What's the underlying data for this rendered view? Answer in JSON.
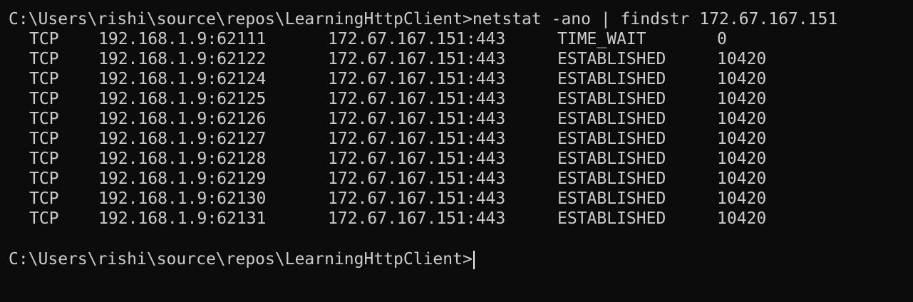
{
  "terminal": {
    "command_line": "C:\\Users\\rishi\\source\\repos\\LearningHttpClient>netstat -ano | findstr 172.67.167.151",
    "rows": [
      {
        "proto": "TCP",
        "local": "192.168.1.9:62111",
        "foreign": "172.67.167.151:443",
        "state": "TIME_WAIT",
        "pid": "0"
      },
      {
        "proto": "TCP",
        "local": "192.168.1.9:62122",
        "foreign": "172.67.167.151:443",
        "state": "ESTABLISHED",
        "pid": "10420"
      },
      {
        "proto": "TCP",
        "local": "192.168.1.9:62124",
        "foreign": "172.67.167.151:443",
        "state": "ESTABLISHED",
        "pid": "10420"
      },
      {
        "proto": "TCP",
        "local": "192.168.1.9:62125",
        "foreign": "172.67.167.151:443",
        "state": "ESTABLISHED",
        "pid": "10420"
      },
      {
        "proto": "TCP",
        "local": "192.168.1.9:62126",
        "foreign": "172.67.167.151:443",
        "state": "ESTABLISHED",
        "pid": "10420"
      },
      {
        "proto": "TCP",
        "local": "192.168.1.9:62127",
        "foreign": "172.67.167.151:443",
        "state": "ESTABLISHED",
        "pid": "10420"
      },
      {
        "proto": "TCP",
        "local": "192.168.1.9:62128",
        "foreign": "172.67.167.151:443",
        "state": "ESTABLISHED",
        "pid": "10420"
      },
      {
        "proto": "TCP",
        "local": "192.168.1.9:62129",
        "foreign": "172.67.167.151:443",
        "state": "ESTABLISHED",
        "pid": "10420"
      },
      {
        "proto": "TCP",
        "local": "192.168.1.9:62130",
        "foreign": "172.67.167.151:443",
        "state": "ESTABLISHED",
        "pid": "10420"
      },
      {
        "proto": "TCP",
        "local": "192.168.1.9:62131",
        "foreign": "172.67.167.151:443",
        "state": "ESTABLISHED",
        "pid": "10420"
      }
    ],
    "prompt": "C:\\Users\\rishi\\source\\repos\\LearningHttpClient>",
    "colors": {
      "background": "#0c0c0c",
      "foreground": "#cccccc",
      "cursor": "#f2f2f2"
    }
  }
}
